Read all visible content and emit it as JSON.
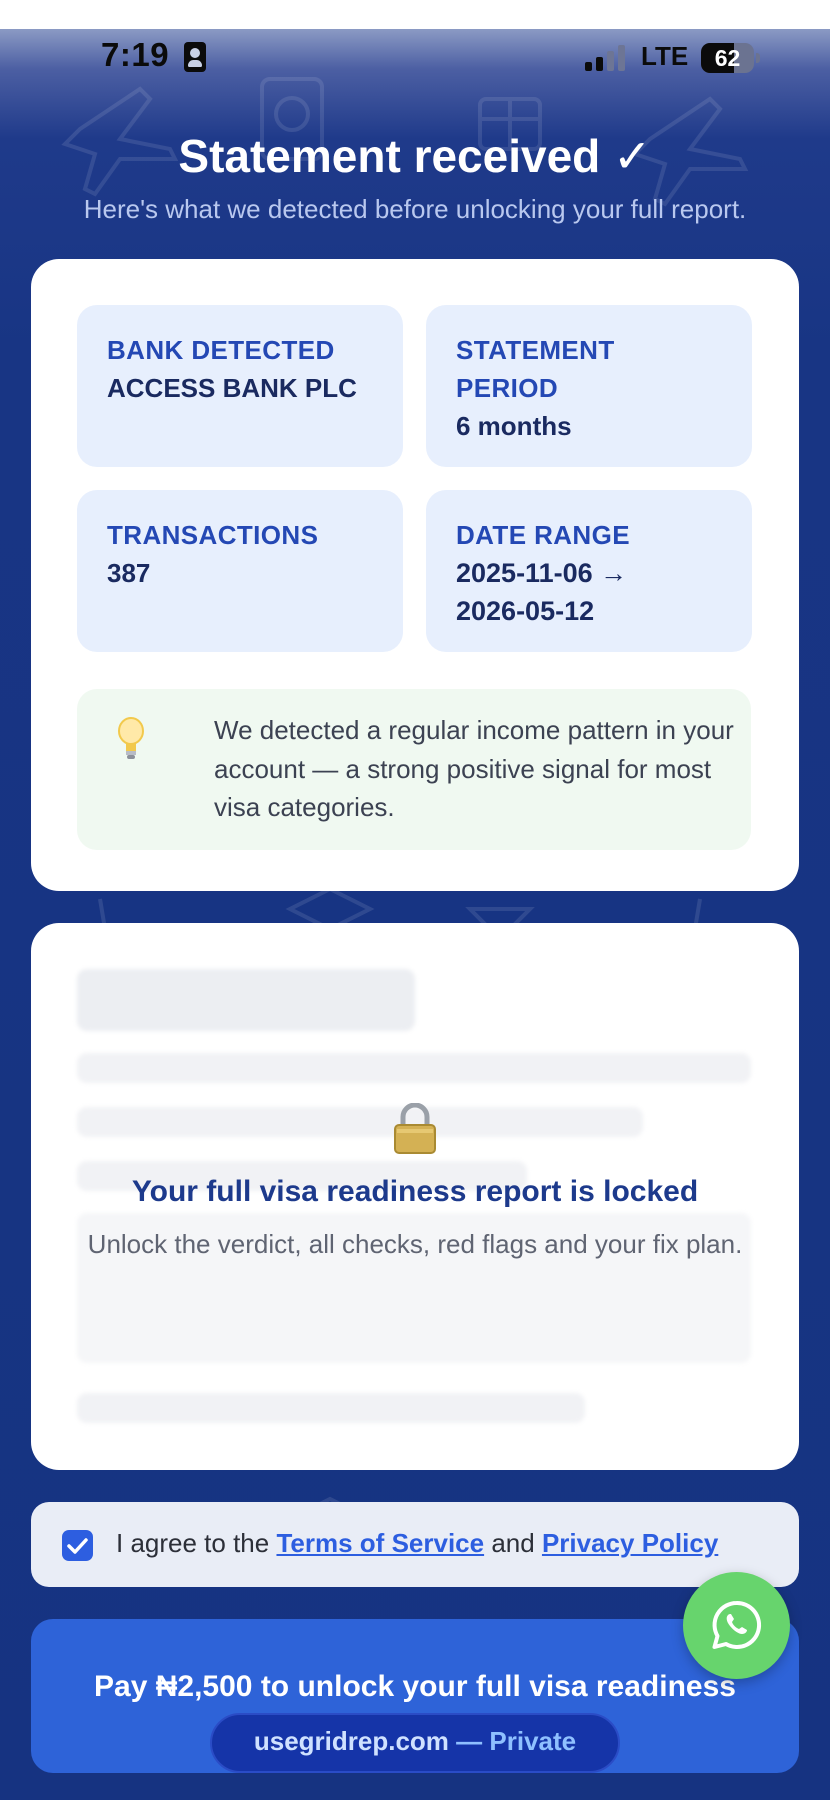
{
  "status_bar": {
    "time": "7:19",
    "network": "LTE",
    "battery_percent": "62",
    "battery_level": 0.62
  },
  "header": {
    "title": "Statement received ✓",
    "subtitle": "Here's what we detected before unlocking your full report."
  },
  "summary": {
    "bank": {
      "label": "BANK DETECTED",
      "value": "ACCESS BANK PLC"
    },
    "period": {
      "label_line1": "STATEMENT",
      "label_line2": "PERIOD",
      "value": "6 months"
    },
    "transactions": {
      "label": "TRANSACTIONS",
      "value": "387"
    },
    "date_range": {
      "label": "DATE RANGE",
      "start": "2025-11-06 →",
      "end": "2026-05-12"
    },
    "insight": {
      "icon": "lightbulb-icon",
      "text": "We detected a regular income pattern in your account — a strong positive signal for most visa categories."
    }
  },
  "locked_report": {
    "icon": "lock-icon",
    "title": "Your full visa readiness report is locked",
    "subtitle": "Unlock the verdict, all checks, red flags and your fix plan."
  },
  "agreement": {
    "checked": true,
    "prefix": "I agree to the",
    "terms_link": "Terms of Service",
    "conjunction": "and",
    "privacy_link": "Privacy Policy"
  },
  "pay_button": {
    "label": "Pay ₦2,500 to unlock your full visa readiness report"
  },
  "browser": {
    "domain": "usegridrep.com",
    "suffix": "— Private"
  },
  "colors": {
    "background": "#183584",
    "accent": "#2e63d8",
    "tile": "#e7effd",
    "insight": "#f0f9f1",
    "whatsapp": "#67d46d"
  }
}
